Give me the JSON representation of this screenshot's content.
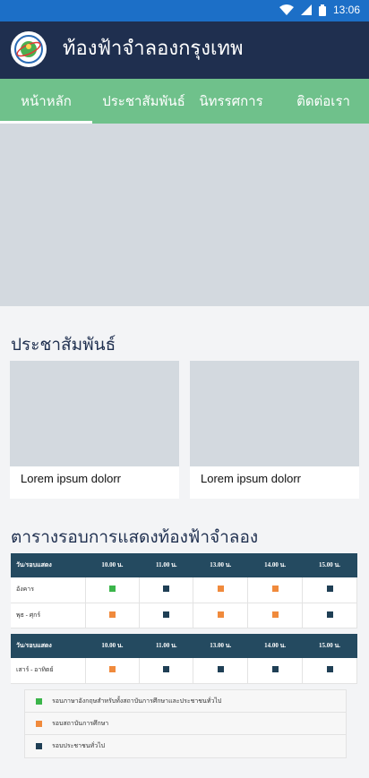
{
  "status_bar": {
    "time": "13:06",
    "icons": [
      "wifi-icon",
      "signal-icon",
      "battery-icon"
    ]
  },
  "app_bar": {
    "title": "ท้องฟ้าจำลองกรุงเทพ"
  },
  "tabs": [
    {
      "label": "หน้าหลัก",
      "active": true
    },
    {
      "label": "ประชาสัมพันธ์",
      "active": false
    },
    {
      "label": "นิทรรศการ",
      "active": false
    },
    {
      "label": "ติดต่อเรา",
      "active": false
    }
  ],
  "news": {
    "title": "ประชาสัมพันธ์",
    "cards": [
      {
        "caption": "Lorem ipsum dolorr"
      },
      {
        "caption": "Lorem ipsum dolorr"
      }
    ]
  },
  "schedule": {
    "title": "ตารางรอบการแสดงท้องฟ้าจำลอง",
    "header": [
      "วัน/รอบแสดง",
      "10.00 น.",
      "11.00 น.",
      "13.00 น.",
      "14.00 น.",
      "15.00 น."
    ],
    "table1_rows": [
      {
        "day": "อังคาร",
        "marks": [
          "green",
          "navy",
          "orange",
          "orange",
          "navy"
        ]
      },
      {
        "day": "พุธ - ศุกร์",
        "marks": [
          "orange",
          "navy",
          "orange",
          "orange",
          "navy"
        ]
      }
    ],
    "table2_rows": [
      {
        "day": "เสาร์ - อาทิตย์",
        "marks": [
          "orange",
          "navy",
          "navy",
          "navy",
          "navy"
        ]
      }
    ],
    "legend": [
      {
        "color": "green",
        "text": "รอบภาษาอังกฤษสำหรับทั้งสถาบันการศึกษาและประชาชนทั่วไป"
      },
      {
        "color": "orange",
        "text": "รอบสถาบันการศึกษา"
      },
      {
        "color": "navy",
        "text": "รอบประชาชนทั่วไป"
      }
    ]
  },
  "colors": {
    "status_bar": "#1c6fc7",
    "app_bar": "#1f2f4f",
    "tab_bar": "#6fc18b",
    "table_header": "#244a60",
    "green": "#3bb54a",
    "orange": "#f08a3c",
    "navy": "#1f3f55"
  }
}
